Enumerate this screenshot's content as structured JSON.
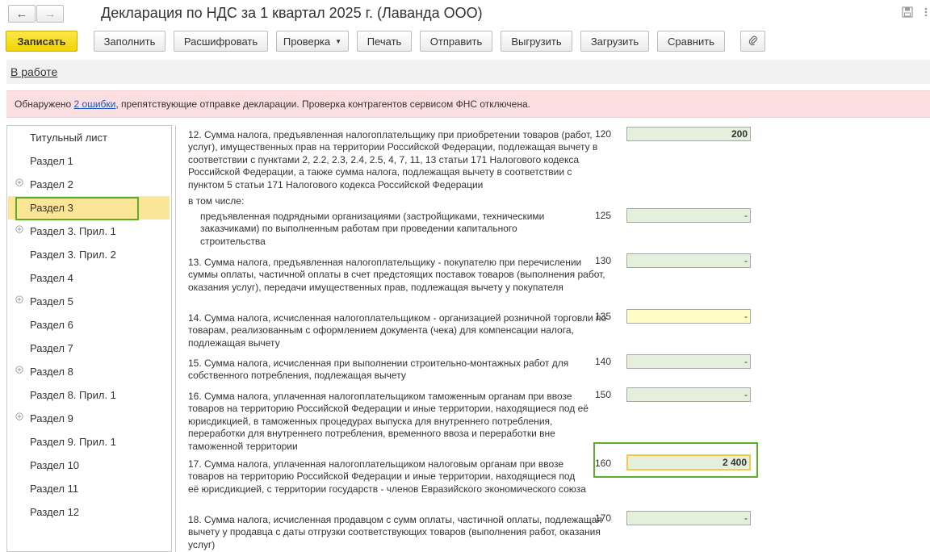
{
  "window": {
    "title": "Декларация по НДС за 1 квартал 2025 г. (Лаванда ООО)",
    "back_glyph": "←",
    "forward_glyph": "→",
    "icons": [
      "save-icon",
      "more-icon",
      "close-icon"
    ]
  },
  "toolbar": {
    "save": "Записать",
    "fill": "Заполнить",
    "decode": "Расшифровать",
    "check": "Проверка",
    "print": "Печать",
    "send": "Отправить",
    "export": "Выгрузить",
    "import": "Загрузить",
    "compare": "Сравнить",
    "attach_icon": "paperclip-icon"
  },
  "status": {
    "label": "В работе"
  },
  "error": {
    "prefix": "Обнаружено ",
    "link": "2 ошибки",
    "suffix": ", препятствующие отправке декларации. Проверка контрагентов сервисом ФНС отключена."
  },
  "sidebar": {
    "items": [
      {
        "label": "Титульный лист",
        "expandable": false
      },
      {
        "label": "Раздел 1",
        "expandable": false
      },
      {
        "label": "Раздел 2",
        "expandable": true
      },
      {
        "label": "Раздел 3",
        "expandable": false,
        "selected": true
      },
      {
        "label": "Раздел 3. Прил. 1",
        "expandable": true
      },
      {
        "label": "Раздел 3. Прил. 2",
        "expandable": false
      },
      {
        "label": "Раздел 4",
        "expandable": false
      },
      {
        "label": "Раздел 5",
        "expandable": true
      },
      {
        "label": "Раздел 6",
        "expandable": false
      },
      {
        "label": "Раздел 7",
        "expandable": false
      },
      {
        "label": "Раздел 8",
        "expandable": true
      },
      {
        "label": "Раздел 8. Прил. 1",
        "expandable": false
      },
      {
        "label": "Раздел 9",
        "expandable": true
      },
      {
        "label": "Раздел 9. Прил. 1",
        "expandable": false
      },
      {
        "label": "Раздел 10",
        "expandable": false
      },
      {
        "label": "Раздел 11",
        "expandable": false
      },
      {
        "label": "Раздел 12",
        "expandable": false
      }
    ]
  },
  "form": {
    "including": "в том числе:",
    "rows": [
      {
        "text": "12. Сумма налога, предъявленная налогоплательщику при приобретении товаров (работ, услуг), имущественных прав на территории Российской Федерации, подлежащая вычету в соответствии с пунктами 2, 2.2, 2.3, 2.4, 2.5, 4, 7, 11, 13 статьи 171 Налогового кодекса Российской Федерации, а также сумма налога, подлежащая вычету в соответствии с пунктом 5 статьи 171 Налогового кодекса Российской Федерации",
        "code": "120",
        "value": "200"
      },
      {
        "text": "предъявленная подрядными организациями (застройщиками, техническими заказчиками) по выполненным работам при проведении капитального строительства",
        "code": "125",
        "value": "-"
      },
      {
        "text": "13. Сумма налога, предъявленная налогоплательщику - покупателю при перечислении суммы оплаты, частичной оплаты в счет предстоящих поставок товаров (выполнения работ, оказания услуг), передачи имущественных прав, подлежащая вычету у покупателя",
        "code": "130",
        "value": "-"
      },
      {
        "text": "14. Сумма налога, исчисленная налогоплательщиком - организацией розничной торговли по товарам, реализованным с оформлением документа (чека) для компенсации налога, подлежащая вычету",
        "code": "135",
        "value": "-"
      },
      {
        "text": "15. Сумма налога, исчисленная при выполнении строительно-монтажных работ для собственного потребления, подлежащая вычету",
        "code": "140",
        "value": "-"
      },
      {
        "text": "16. Сумма налога, уплаченная налогоплательщиком таможенным органам при ввозе товаров на территорию Российской Федерации и иные территории, находящиеся под её юрисдикцией, в таможенных процедурах выпуска для внутреннего потребления, переработки для внутреннего потребления, временного ввоза и переработки вне таможенной территории",
        "code": "150",
        "value": "-"
      },
      {
        "text": "17. Сумма налога, уплаченная налогоплательщиком налоговым органам при ввозе товаров на территорию Российской Федерации и иные территории, находящиеся под её юрисдикцией, с территории государств - членов Евразийского экономического союза",
        "code": "160",
        "value": "2 400"
      },
      {
        "text": "18. Сумма налога, исчисленная продавцом с сумм оплаты, частичной оплаты, подлежащая вычету у продавца с даты отгрузки соответствующих товаров (выполнения работ, оказания услуг)",
        "code": "170",
        "value": "-"
      }
    ]
  },
  "colors": {
    "primary_button": "#f1d400",
    "selected_item": "#fbe597",
    "highlight_border": "#5aae2c",
    "field_fill": "#e4efdc",
    "field_yellow": "#fffcc5",
    "error_bar": "#fbdfe0",
    "link": "#1a55c0"
  }
}
